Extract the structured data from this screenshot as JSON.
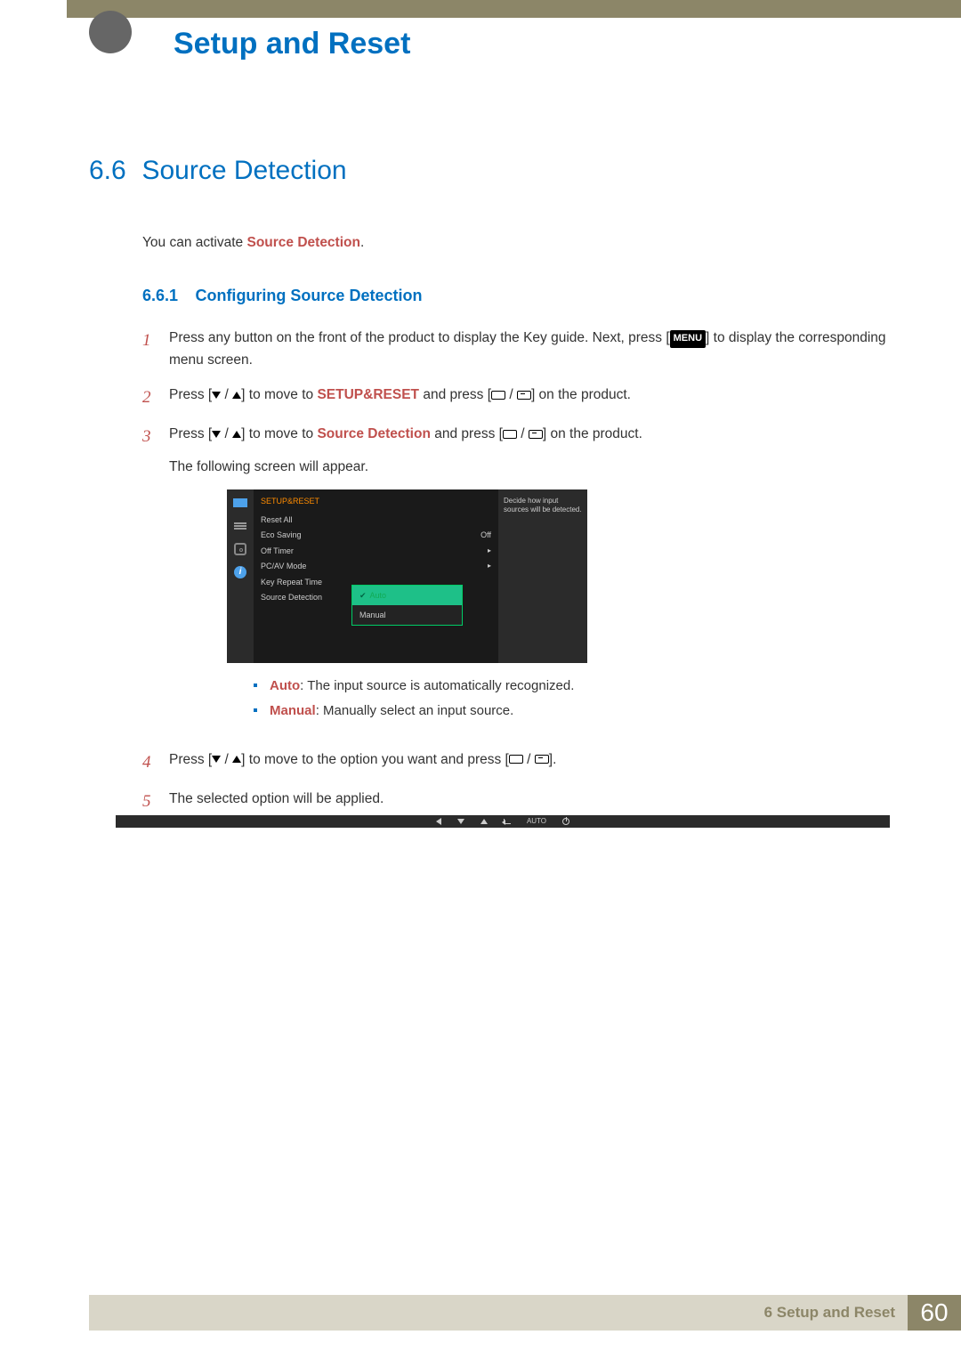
{
  "chapter_title": "Setup and Reset",
  "section": {
    "num": "6.6",
    "title": "Source Detection"
  },
  "intro_prefix": "You can activate ",
  "intro_bold": "Source Detection",
  "intro_suffix": ".",
  "subsection": {
    "num": "6.6.1",
    "title": "Configuring Source Detection"
  },
  "steps": {
    "s1": {
      "n": "1",
      "a": "Press any button on the front of the product to display the Key guide. Next, press [",
      "menu": "MENU",
      "b": "] to display the corresponding menu screen."
    },
    "s2": {
      "n": "2",
      "a": "Press [",
      "b": "] to move to ",
      "bold": "SETUP&RESET",
      "c": " and press [",
      "d": "] on the product."
    },
    "s3": {
      "n": "3",
      "a": "Press [",
      "b": "] to move to ",
      "bold": "Source Detection",
      "c": " and press [",
      "d": "] on the product.",
      "e": "The following screen will appear."
    },
    "s4": {
      "n": "4",
      "a": "Press [",
      "b": "] to move to the option you want and press [",
      "c": "]."
    },
    "s5": {
      "n": "5",
      "a": "The selected option will be applied."
    }
  },
  "osd": {
    "header": "SETUP&RESET",
    "items": [
      {
        "label": "Reset All",
        "value": ""
      },
      {
        "label": "Eco Saving",
        "value": "Off"
      },
      {
        "label": "Off Timer",
        "value": "▸"
      },
      {
        "label": "PC/AV Mode",
        "value": "▸"
      },
      {
        "label": "Key Repeat Time",
        "value": ""
      },
      {
        "label": "Source Detection",
        "value": ""
      }
    ],
    "popup": {
      "selected": "Auto",
      "opt2": "Manual"
    },
    "hint": "Decide how input sources will be detected.",
    "bar_auto": "AUTO"
  },
  "bullets": {
    "auto_label": "Auto",
    "auto_text": ": The input source is automatically recognized.",
    "manual_label": "Manual",
    "manual_text": ": Manually select an input source."
  },
  "footer": {
    "text": "6 Setup and Reset",
    "page": "60"
  }
}
